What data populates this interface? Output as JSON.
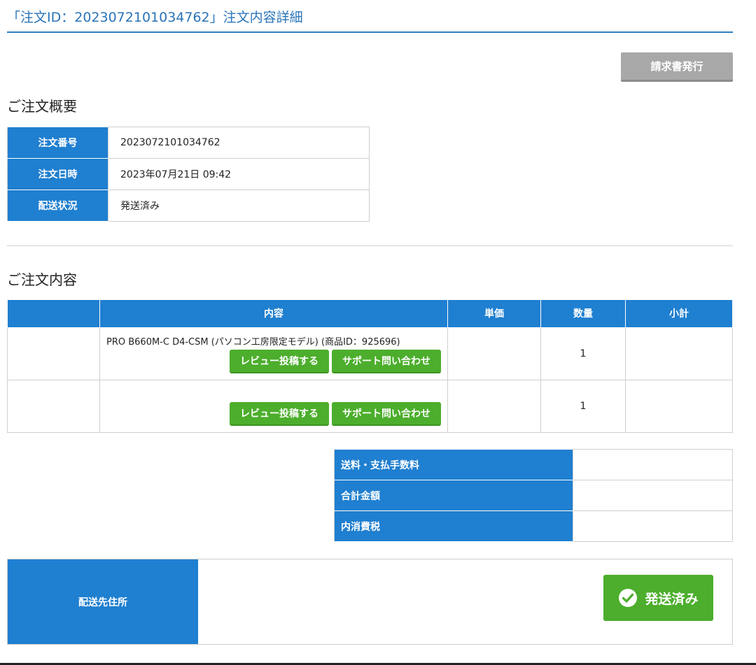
{
  "header": {
    "title": "「注文ID：2023072101034762」注文内容詳細"
  },
  "invoice_button": "請求書発行",
  "summary": {
    "heading": "ご注文概要",
    "rows": [
      {
        "label": "注文番号",
        "value": "2023072101034762"
      },
      {
        "label": "注文日時",
        "value": "2023年07月21日 09:42"
      },
      {
        "label": "配送状況",
        "value": "発送済み"
      }
    ]
  },
  "items": {
    "heading": "ご注文内容",
    "columns": [
      "",
      "内容",
      "単価",
      "数量",
      "小計"
    ],
    "rows": [
      {
        "name": "PRO B660M-C D4-CSM (パソコン工房限定モデル) (商品ID：925696)",
        "price": "",
        "quantity": "1",
        "subtotal": "",
        "review_label": "レビュー投稿する",
        "support_label": "サポート問い合わせ"
      },
      {
        "name": "",
        "price": "",
        "quantity": "1",
        "subtotal": "",
        "review_label": "レビュー投稿する",
        "support_label": "サポート問い合わせ"
      }
    ]
  },
  "totals": [
    {
      "label": "送料・支払手数料",
      "value": ""
    },
    {
      "label": "合計金額",
      "value": ""
    },
    {
      "label": "内消費税",
      "value": ""
    }
  ],
  "shipping": {
    "label": "配送先住所",
    "address": "",
    "status_badge": "発送済み"
  },
  "colors": {
    "header_blue": "#1f7fd0",
    "title_blue": "#2a74b8",
    "button_green": "#4cae2c",
    "invoice_gray": "#a8a8a8"
  }
}
